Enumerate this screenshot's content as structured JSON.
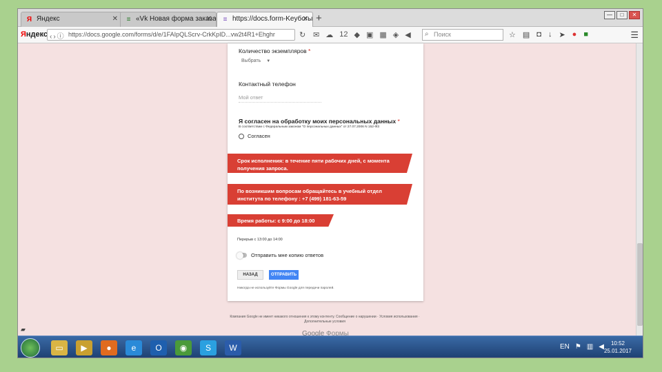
{
  "tabs": [
    {
      "title": "Яндекс",
      "icon": "Я"
    },
    {
      "title": "«Vk Новая форма заказа ...",
      "icon": "≡"
    },
    {
      "title": "https://docs.form-Keyбorы",
      "icon": "≡"
    }
  ],
  "nav": {
    "logo_prefix": "Я",
    "logo_text": "ндекс",
    "url": "https://docs.google.com/forms/d/e/1FAIpQLScrv-CrkKpID...vw2t4R1+Ehghr",
    "search_placeholder": "Поиск",
    "weather_temp": "12"
  },
  "form": {
    "q_copies": "Количество экземпляров",
    "q_copies_req": "*",
    "dropdown": "Выбрать",
    "q_phone": "Контактный телефон",
    "answer_placeholder": "Мой ответ",
    "consent_title": "Я согласен на обработку моих персональных данных",
    "consent_req": "*",
    "consent_sub": "В соответствии с Федеральным законом \"О персональных данных\" от 27.07.2006 N 152-ФЗ",
    "radio_label": "Согласен",
    "banner1": "Срок исполнения: в течение пяти рабочих дней, с момента получения запроса.",
    "banner2": "По возникшим вопросам обращайтесь в учебный отдел института по телефону : +7 (499) 181-63-59",
    "banner3": "Время работы: с 9:00 до 18:00",
    "break_text": "Перерыв с 13:00 до 14:00",
    "toggle_label": "Отправить мне копию ответов",
    "back_button": "НАЗАД",
    "submit_button": "ОТПРАВИТЬ",
    "password_note": "Никогда не используйте Формы Google для передачи паролей."
  },
  "footer": {
    "text": "Компания Google не имеет никакого отношения к этому контенту. Сообщение о нарушении · Условия использования · Дополнительные условия",
    "brand_google": "Google",
    "brand_forms": "Формы"
  },
  "taskbar": {
    "time": "10:52",
    "date": "25.01.2017",
    "lang": "EN"
  },
  "colors": {
    "banner": "#d93f34",
    "submit": "#4285f4",
    "page_bg": "#f5e1e1"
  }
}
